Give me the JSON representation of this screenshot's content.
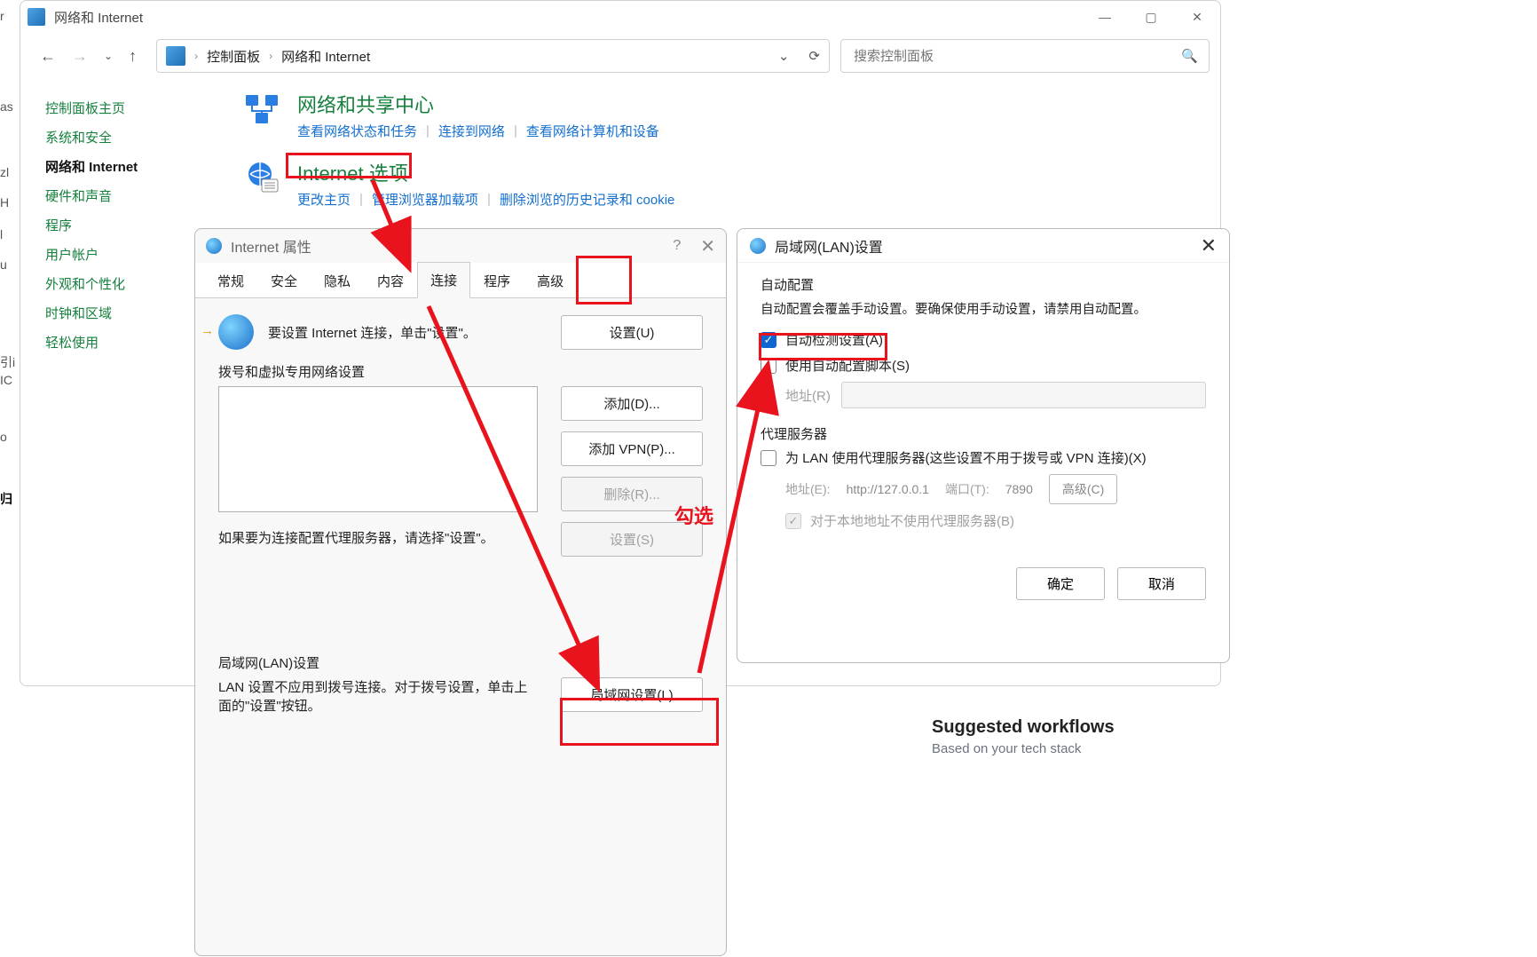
{
  "controlPanel": {
    "windowTitle": "网络和 Internet",
    "breadcrumbs": {
      "root": "控制面板",
      "current": "网络和 Internet"
    },
    "search": {
      "placeholder": "搜索控制面板"
    },
    "winctl": {
      "min": "—",
      "max": "▢",
      "close": "✕"
    },
    "nav": {
      "back": "←",
      "forward": "→",
      "up": "↑",
      "dropdown": "⌄",
      "refresh": "⟳"
    },
    "sidebar": {
      "items": [
        {
          "label": "控制面板主页",
          "kind": "link"
        },
        {
          "label": "系统和安全",
          "kind": "link"
        },
        {
          "label": "网络和 Internet",
          "kind": "active"
        },
        {
          "label": "硬件和声音",
          "kind": "link"
        },
        {
          "label": "程序",
          "kind": "link"
        },
        {
          "label": "用户帐户",
          "kind": "link"
        },
        {
          "label": "外观和个性化",
          "kind": "link"
        },
        {
          "label": "时钟和区域",
          "kind": "link"
        },
        {
          "label": "轻松使用",
          "kind": "link"
        }
      ]
    },
    "sections": [
      {
        "title": "网络和共享中心",
        "links": [
          "查看网络状态和任务",
          "连接到网络",
          "查看网络计算机和设备"
        ]
      },
      {
        "title": "Internet 选项",
        "links": [
          "更改主页",
          "管理浏览器加载项",
          "删除浏览的历史记录和 cookie"
        ]
      }
    ],
    "linkSep": "|"
  },
  "internetProps": {
    "title": "Internet 属性",
    "helpGlyph": "?",
    "closeGlyph": "✕",
    "tabs": [
      "常规",
      "安全",
      "隐私",
      "内容",
      "连接",
      "程序",
      "高级"
    ],
    "activeTab": "连接",
    "connText": "要设置 Internet 连接，单击\"设置\"。",
    "setupButton": "设置(U)",
    "dialSection": "拨号和虚拟专用网络设置",
    "addButton": "添加(D)...",
    "addVpnButton": "添加 VPN(P)...",
    "removeButton": "删除(R)...",
    "settingsButton": "设置(S)",
    "proxyText": "如果要为连接配置代理服务器，请选择\"设置\"。",
    "lanSection": "局域网(LAN)设置",
    "lanHelpText": "LAN 设置不应用到拨号连接。对于拨号设置，单击上面的\"设置\"按钮。",
    "lanButton": "局域网设置(L)"
  },
  "lanSettings": {
    "title": "局域网(LAN)设置",
    "closeGlyph": "✕",
    "autoGroup": "自动配置",
    "autoHelp": "自动配置会覆盖手动设置。要确保使用手动设置，请禁用自动配置。",
    "autoDetect": "自动检测设置(A)",
    "useScript": "使用自动配置脚本(S)",
    "addressLabel": "地址(R)",
    "proxyGroup": "代理服务器",
    "useProxy": "为 LAN 使用代理服务器(这些设置不用于拨号或 VPN 连接)(X)",
    "proxyAddressLabel": "地址(E):",
    "proxyAddressValue": "http://127.0.0.1",
    "proxyPortLabel": "端口(T):",
    "proxyPortValue": "7890",
    "advancedButton": "高级(C)",
    "bypassLocal": "对于本地地址不使用代理服务器(B)",
    "okButton": "确定",
    "cancelButton": "取消"
  },
  "annotations": {
    "checkLabel": "勾选"
  },
  "suggested": {
    "title": "Suggested workflows",
    "subtitle": "Based on your tech stack"
  },
  "leftFragments": [
    "r",
    "as",
    "zl",
    "H",
    "l",
    "u",
    "引i",
    "IC",
    "o",
    "归",
    ""
  ]
}
